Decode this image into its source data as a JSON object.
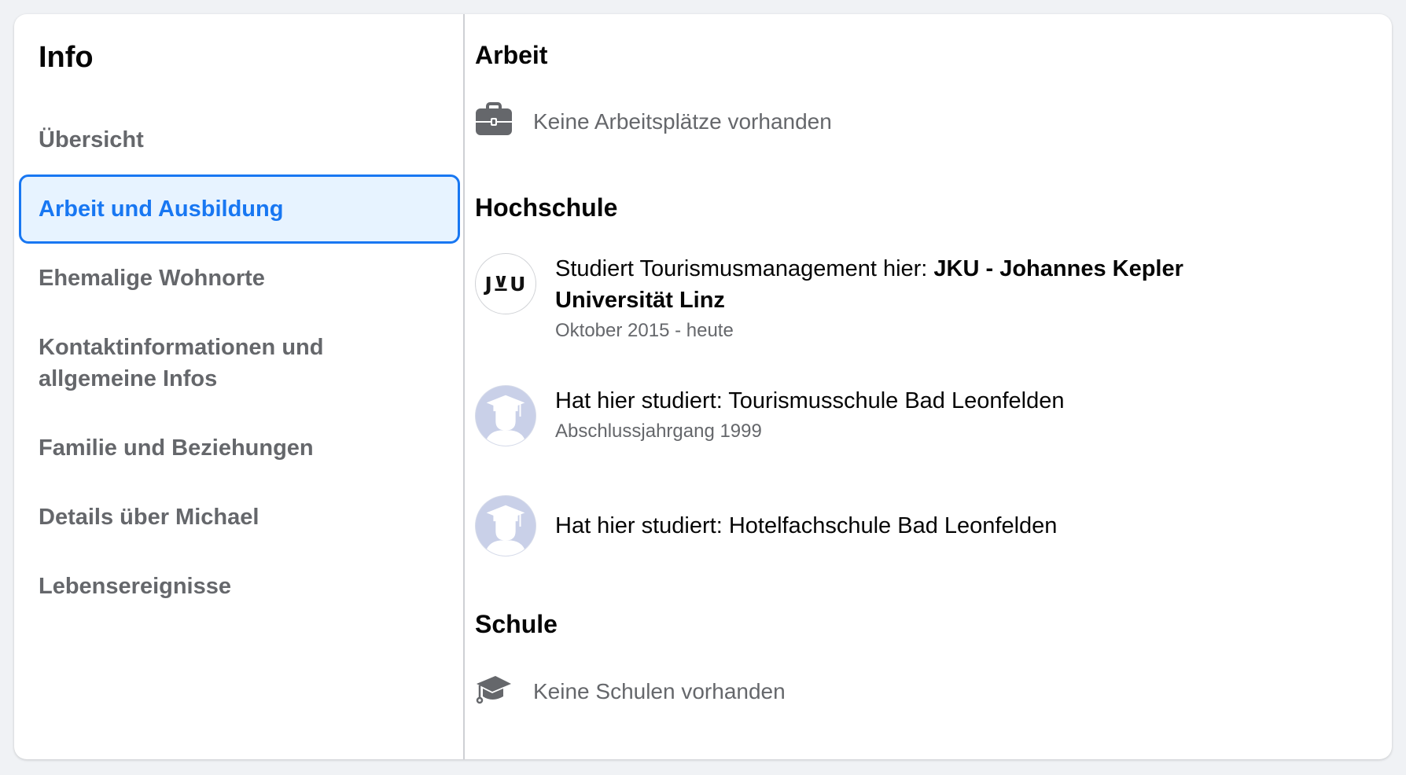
{
  "sidebar": {
    "title": "Info",
    "items": [
      {
        "label": "Übersicht",
        "active": false
      },
      {
        "label": "Arbeit und Ausbildung",
        "active": true
      },
      {
        "label": "Ehemalige Wohnorte",
        "active": false
      },
      {
        "label": "Kontaktinformationen und allgemeine Infos",
        "active": false
      },
      {
        "label": "Familie und Beziehungen",
        "active": false
      },
      {
        "label": "Details über Michael",
        "active": false
      },
      {
        "label": "Lebensereignisse",
        "active": false
      }
    ]
  },
  "work": {
    "heading": "Arbeit",
    "icon": "briefcase-icon",
    "empty_text": "Keine Arbeitsplätze vorhanden"
  },
  "college": {
    "heading": "Hochschule",
    "entries": [
      {
        "prefix": "Studiert Tourismusmanagement hier: ",
        "school": "JKU - Johannes Kepler Universität Linz",
        "sub": "Oktober 2015 - heute",
        "avatar": "jku-logo",
        "logo_text": "J⊻U"
      },
      {
        "prefix": "Hat hier studiert: ",
        "school": "Tourismusschule Bad Leonfelden",
        "sub": "Abschlussjahrgang 1999",
        "avatar": "graduate-placeholder-icon"
      },
      {
        "prefix": "Hat hier studiert: ",
        "school": "Hotelfachschule Bad Leonfelden",
        "sub": "",
        "avatar": "graduate-placeholder-icon"
      }
    ]
  },
  "school": {
    "heading": "Schule",
    "icon": "graduation-cap-icon",
    "empty_text": "Keine Schulen vorhanden"
  },
  "colors": {
    "accent": "#1877f2",
    "accent_bg": "#e7f3ff",
    "secondary_text": "#65676b",
    "page_bg": "#f0f2f5"
  }
}
